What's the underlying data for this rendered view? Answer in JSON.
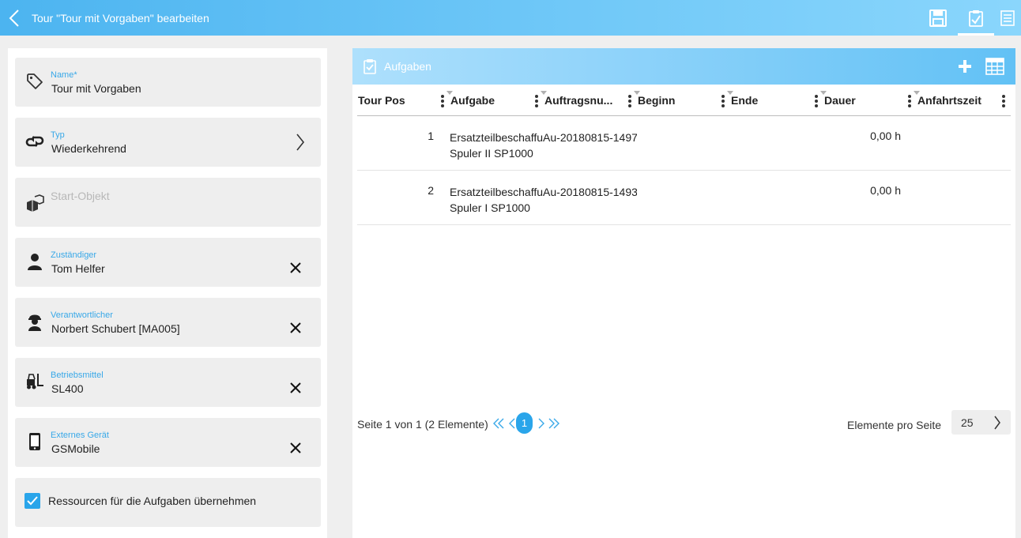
{
  "window": {
    "title": "Tour \"Tour mit Vorgaben\" bearbeiten"
  },
  "toolbar": {
    "icons": [
      "back-arrow-icon",
      "save-icon",
      "clipboard-check-icon",
      "list-form-icon"
    ]
  },
  "form": {
    "name": {
      "label": "Name*",
      "value": "Tour mit Vorgaben"
    },
    "typ": {
      "label": "Typ",
      "value": "Wiederkehrend"
    },
    "start_objekt": {
      "placeholder": "Start-Objekt"
    },
    "zustaendiger": {
      "label": "Zuständiger",
      "value": "Tom Helfer"
    },
    "verantwortlicher": {
      "label": "Verantwortlicher",
      "value": "Norbert Schubert [MA005]"
    },
    "betriebsmittel": {
      "label": "Betriebsmittel",
      "value": "SL400"
    },
    "externes_geraet": {
      "label": "Externes Gerät",
      "value": "GSMobile"
    },
    "ressourcen": {
      "label": "Ressourcen für die Aufgaben übernehmen",
      "checked": true
    }
  },
  "tasks_panel": {
    "title": "Aufgaben",
    "columns": [
      {
        "key": "pos",
        "label": "Tour Pos"
      },
      {
        "key": "aufgabe",
        "label": "Aufgabe"
      },
      {
        "key": "auftragsnummer",
        "label": "Auftragsnu..."
      },
      {
        "key": "beginn",
        "label": "Beginn"
      },
      {
        "key": "ende",
        "label": "Ende"
      },
      {
        "key": "dauer",
        "label": "Dauer"
      },
      {
        "key": "anfahrtszeit",
        "label": "Anfahrtszeit"
      }
    ],
    "rows": [
      {
        "pos": "1",
        "aufgabe_line1": "ErsatzteilbeschaffuAu-20180815-1497",
        "aufgabe_line2": "Spuler II SP1000",
        "beginn": "",
        "ende": "",
        "dauer": "0,00 h",
        "anfahrtszeit": ""
      },
      {
        "pos": "2",
        "aufgabe_line1": "ErsatzteilbeschaffuAu-20180815-1493",
        "aufgabe_line2": "Spuler I SP1000",
        "beginn": "",
        "ende": "",
        "dauer": "0,00 h",
        "anfahrtszeit": ""
      }
    ],
    "pager": {
      "info": "Seite 1 von 1 (2 Elemente)",
      "current_page": "1",
      "page_size_label": "Elemente pro Seite",
      "page_size": "25"
    }
  },
  "colors": {
    "accent": "#2aa5ea",
    "topbar_start": "#4cb4f0",
    "label": "#38a8e8"
  }
}
